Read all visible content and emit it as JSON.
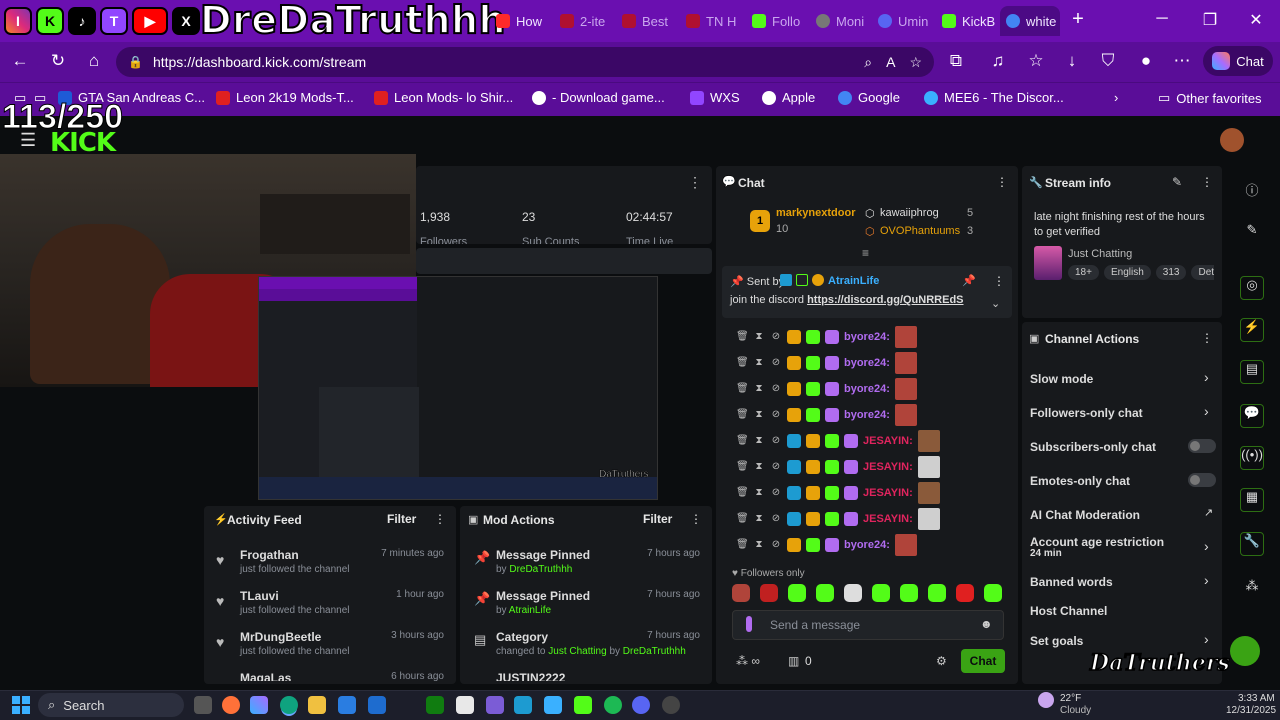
{
  "overlay": {
    "streamer_name": "DreDaTruthhh",
    "socials": [
      "I",
      "K",
      "♪",
      "T",
      "▶",
      "X"
    ],
    "follower_goal": "113/250",
    "watermark": "DaTruthers"
  },
  "browser": {
    "tabs": [
      {
        "label": "How",
        "color": "#ff2a2a"
      },
      {
        "label": "2-ite",
        "color": "#ff2a2a"
      },
      {
        "label": "Best",
        "color": "#ff2a2a"
      },
      {
        "label": "TN H",
        "color": "#ff2a2a"
      },
      {
        "label": "Follo",
        "color": "#53fc18"
      },
      {
        "label": "Moni",
        "color": "#888"
      },
      {
        "label": "Umin",
        "color": "#5865f2"
      },
      {
        "label": "KickB",
        "color": "#53fc18"
      },
      {
        "label": "white",
        "color": "#4285f4"
      }
    ],
    "url": "https://dashboard.kick.com/stream",
    "chat_button": "Chat",
    "bookmarks": [
      {
        "label": "GTA San Andreas C...",
        "color": "#1e5bd6"
      },
      {
        "label": "Leon 2k19 Mods-T...",
        "color": "#e02020"
      },
      {
        "label": "Leon Mods- lo Shir...",
        "color": "#e02020"
      },
      {
        "label": "- Download game...",
        "color": "#ffffff"
      },
      {
        "label": "WXS",
        "color": "#9146ff"
      },
      {
        "label": "Apple",
        "color": "#ffffff"
      },
      {
        "label": "Google",
        "color": "#4285f4"
      },
      {
        "label": "MEE6 - The Discor...",
        "color": "#3ab0ff"
      }
    ],
    "other_favorites": "Other favorites"
  },
  "dashboard": {
    "logo": "KICK",
    "stats": {
      "followers": "1,938",
      "subs": "23",
      "time_live": "02:44:57",
      "followers_label": "Followers",
      "subs_label": "Sub Counts",
      "time_label": "Time Live"
    },
    "chat_title": "Chat",
    "top_gifters": [
      {
        "name": "markynextdoor",
        "count": "10"
      },
      {
        "name": "kawaiiphrog",
        "count": "5"
      },
      {
        "name": "OVOPhantuums",
        "count": "3"
      }
    ],
    "pinned": {
      "sent_by_label": "Sent by",
      "sender": "AtrainLife",
      "message": "join the discord",
      "link": "https://discord.gg/QuNRREdS"
    },
    "messages": [
      {
        "user": "byore24:",
        "color": "#b16cf0"
      },
      {
        "user": "byore24:",
        "color": "#b16cf0"
      },
      {
        "user": "byore24:",
        "color": "#b16cf0"
      },
      {
        "user": "byore24:",
        "color": "#b16cf0"
      },
      {
        "user": "JESAYIN:",
        "color": "#e0245e"
      },
      {
        "user": "JESAYIN:",
        "color": "#e0245e"
      },
      {
        "user": "JESAYIN:",
        "color": "#e0245e"
      },
      {
        "user": "JESAYIN:",
        "color": "#e0245e"
      },
      {
        "user": "byore24:",
        "color": "#b16cf0"
      }
    ],
    "followers_only": "Followers only",
    "send_placeholder": "Send a message",
    "viewer_count": "0",
    "chat_send": "Chat",
    "stream_info": {
      "title": "Stream info",
      "stream_title": "late night finishing rest of the hours to get verified",
      "category": "Just Chatting",
      "tags": [
        "18+",
        "English",
        "313",
        "Detr"
      ]
    },
    "channel_actions": {
      "title": "Channel Actions",
      "items": [
        {
          "label": "Slow mode",
          "type": "chevron"
        },
        {
          "label": "Followers-only chat",
          "type": "chevron"
        },
        {
          "label": "Subscribers-only chat",
          "type": "toggle"
        },
        {
          "label": "Emotes-only chat",
          "type": "toggle"
        },
        {
          "label": "AI Chat Moderation",
          "type": "external"
        },
        {
          "label": "Account age restriction",
          "type": "chevron",
          "sub": "24 min"
        },
        {
          "label": "Banned words",
          "type": "chevron"
        },
        {
          "label": "Host Channel",
          "type": "none"
        },
        {
          "label": "Set goals",
          "type": "chevron"
        }
      ]
    },
    "activity_feed": {
      "title": "Activity Feed",
      "filter": "Filter",
      "items": [
        {
          "name": "Frogathan",
          "sub": "just followed the channel",
          "time": "7 minutes ago"
        },
        {
          "name": "TLauvi",
          "sub": "just followed the channel",
          "time": "1 hour ago"
        },
        {
          "name": "MrDungBeetle",
          "sub": "just followed the channel",
          "time": "3 hours ago"
        },
        {
          "name": "MagaLas",
          "sub": "",
          "time": "6 hours ago"
        }
      ]
    },
    "mod_actions": {
      "title": "Mod Actions",
      "filter": "Filter",
      "items": [
        {
          "action": "Message Pinned",
          "by": "by",
          "who": "DreDaTruthhh",
          "time": "7 hours ago"
        },
        {
          "action": "Message Pinned",
          "by": "by",
          "who": "AtrainLife",
          "time": "7 hours ago"
        },
        {
          "action": "Category",
          "by": "changed to",
          "who": "Just Chatting",
          "extra": "by",
          "who2": "DreDaTruthhh",
          "time": "7 hours ago"
        },
        {
          "action": "JUSTIN2222",
          "by": "",
          "who": "",
          "time": ""
        }
      ]
    }
  },
  "taskbar": {
    "search": "Search",
    "weather_temp": "22°F",
    "weather_desc": "Cloudy",
    "time": "3:33 AM",
    "date": "12/31/2025"
  }
}
